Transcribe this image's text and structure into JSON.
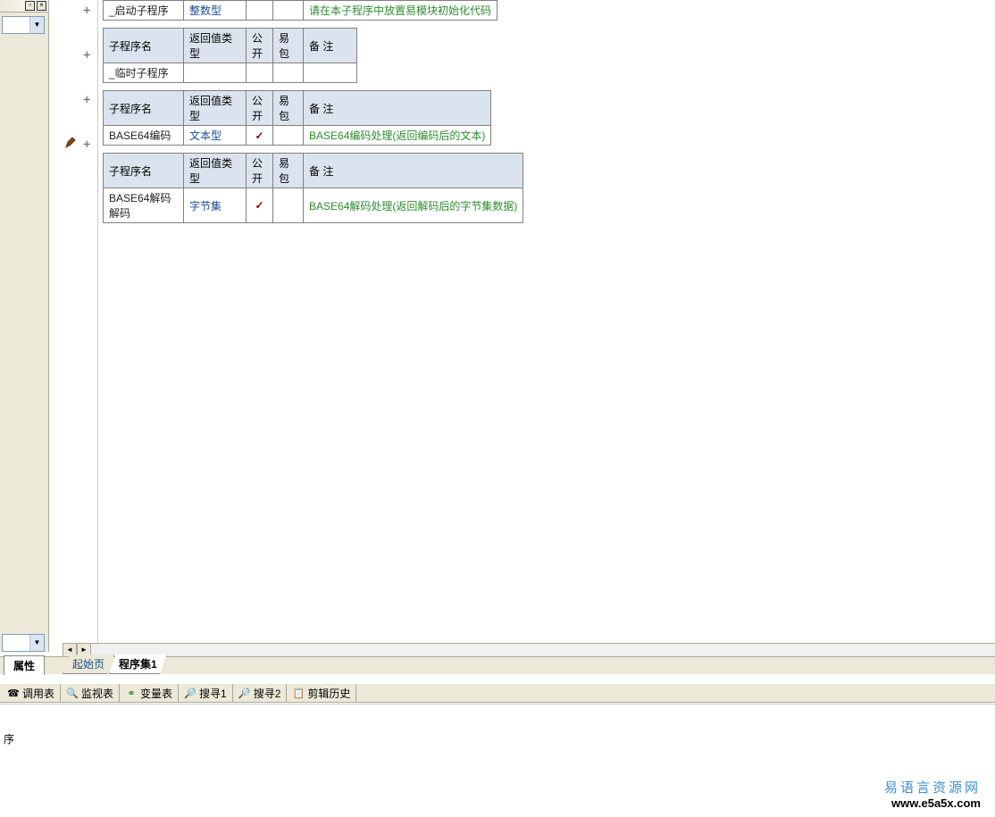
{
  "headers": {
    "sub_name": "子程序名",
    "return_type": "返回值类型",
    "public": "公开",
    "easy_pkg": "易包",
    "note": "备 注"
  },
  "tables": [
    {
      "show_header": false,
      "row": {
        "name": "_启动子程序",
        "rtype": "整数型",
        "public": "",
        "pkg": "",
        "note": "请在本子程序中放置易模块初始化代码"
      }
    },
    {
      "show_header": true,
      "row": {
        "name": "_临时子程序",
        "rtype": "",
        "public": "",
        "pkg": "",
        "note": ""
      }
    },
    {
      "show_header": true,
      "row": {
        "name": "BASE64编码",
        "rtype": "文本型",
        "public": "✓",
        "pkg": "",
        "note": "BASE64编码处理(返回编码后的文本)"
      }
    },
    {
      "show_header": true,
      "cursor": true,
      "row": {
        "name": "BASE64解码解码",
        "rtype": "字节集",
        "public": "✓",
        "pkg": "",
        "note": "BASE64解码处理(返回解码后的字节集数据)"
      }
    }
  ],
  "side_tab": "属性",
  "editor_tabs": [
    {
      "label": "起始页",
      "active": false
    },
    {
      "label": "程序集1",
      "active": true
    }
  ],
  "toolbar": [
    {
      "icon": "call",
      "label": "调用表"
    },
    {
      "icon": "search",
      "label": "监视表"
    },
    {
      "icon": "var",
      "label": "变量表"
    },
    {
      "icon": "find1",
      "label": "搜寻1"
    },
    {
      "icon": "find2",
      "label": "搜寻2"
    },
    {
      "icon": "clip",
      "label": "剪辑历史"
    }
  ],
  "status_text": "序",
  "watermark": {
    "cn": "易语言资源网",
    "en": "www.e5a5x.com"
  }
}
